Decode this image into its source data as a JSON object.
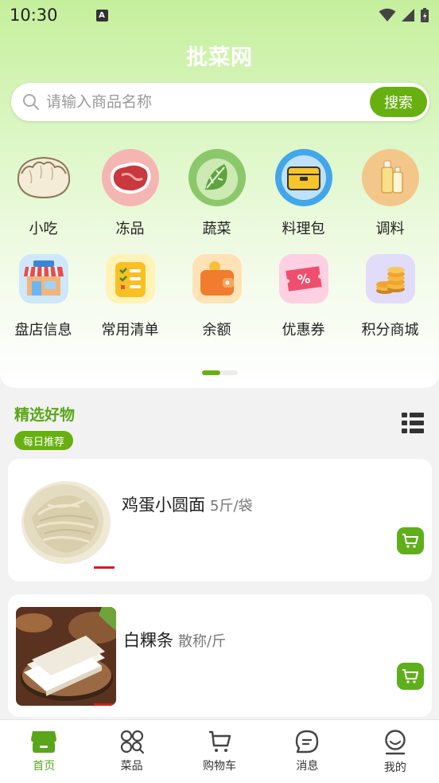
{
  "status": {
    "time": "10:30"
  },
  "app_title": "批菜网",
  "search": {
    "placeholder": "请输入商品名称",
    "button": "搜索"
  },
  "categories": [
    {
      "label": "小吃",
      "icon": "dumpling-icon"
    },
    {
      "label": "冻品",
      "icon": "frozen-meat-icon"
    },
    {
      "label": "蔬菜",
      "icon": "cabbage-icon"
    },
    {
      "label": "料理包",
      "icon": "meal-box-icon"
    },
    {
      "label": "调料",
      "icon": "seasoning-bottles-icon"
    },
    {
      "label": "盘店信息",
      "icon": "store-icon"
    },
    {
      "label": "常用清单",
      "icon": "checklist-icon"
    },
    {
      "label": "余额",
      "icon": "wallet-icon"
    },
    {
      "label": "优惠券",
      "icon": "coupon-icon"
    },
    {
      "label": "积分商城",
      "icon": "coins-icon"
    }
  ],
  "section": {
    "title": "精选好物",
    "badge": "每日推荐"
  },
  "products": [
    {
      "name": "鸡蛋小圆面",
      "unit": "5斤/袋"
    },
    {
      "name": "白粿条",
      "unit": "散称/斤"
    }
  ],
  "tabs": [
    {
      "label": "首页",
      "icon": "home-store-icon",
      "active": true
    },
    {
      "label": "菜品",
      "icon": "category-grid-icon"
    },
    {
      "label": "购物车",
      "icon": "cart-icon"
    },
    {
      "label": "消息",
      "icon": "message-icon"
    },
    {
      "label": "我的",
      "icon": "profile-icon"
    }
  ],
  "colors": {
    "accent": "#67b010",
    "title_green": "#5aa61a"
  }
}
